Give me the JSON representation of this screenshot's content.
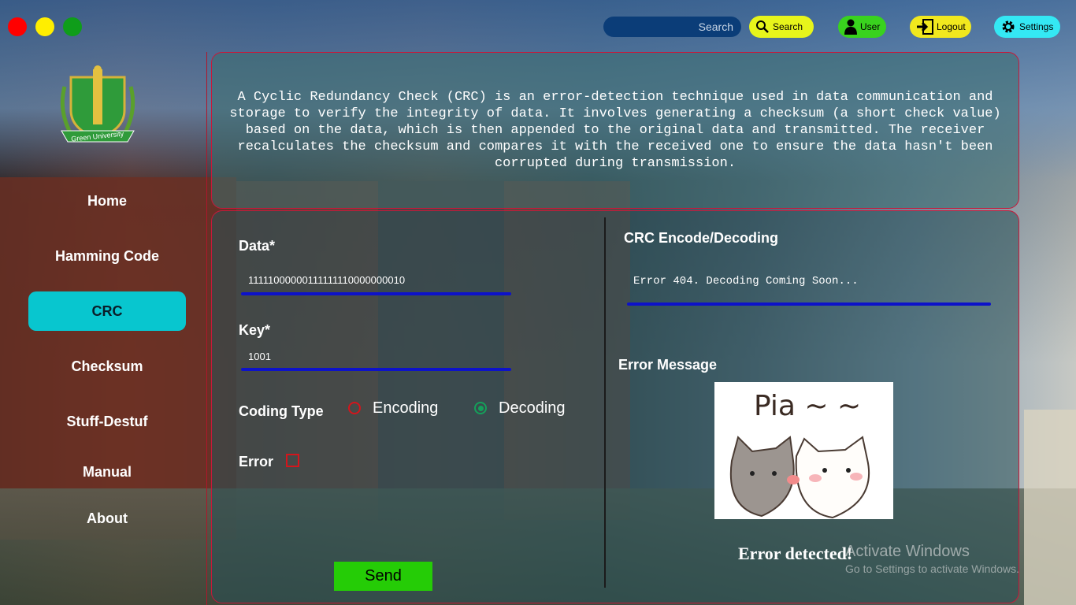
{
  "topbar": {
    "search_placeholder": "Search",
    "search_button": "Search",
    "user_button": "User",
    "logout_button": "Logout",
    "settings_button": "Settings"
  },
  "logo": {
    "text": "Green University"
  },
  "nav": [
    {
      "label": "Home",
      "active": false
    },
    {
      "label": "Hamming Code",
      "active": false
    },
    {
      "label": "CRC",
      "active": true
    },
    {
      "label": "Checksum",
      "active": false
    },
    {
      "label": "Stuff-Destuf",
      "active": false
    },
    {
      "label": "Manual",
      "active": false
    },
    {
      "label": "About",
      "active": false
    }
  ],
  "description": "A Cyclic Redundancy Check (CRC) is an error-detection technique used in data communication and storage to verify the integrity of data. It involves generating a checksum (a short check value) based on the data, which is then appended to the original data and transmitted. The receiver recalculates the checksum and compares it with the received one to ensure the data hasn't been corrupted during transmission.",
  "form": {
    "data_label": "Data*",
    "data_value": "11111000000111111110000000010",
    "key_label": "Key*",
    "key_value": "1001",
    "coding_type_label": "Coding Type",
    "encoding_label": "Encoding",
    "decoding_label": "Decoding",
    "selected": "Decoding",
    "error_label": "Error",
    "error_checked": false,
    "send_label": "Send"
  },
  "output": {
    "title": "CRC Encode/Decoding",
    "value": "Error 404. Decoding Coming Soon...",
    "error_message_label": "Error Message",
    "image_caption": "Pia ~ ~",
    "error_detected": "Error detected!"
  },
  "watermark": {
    "title": "Activate Windows",
    "subtitle": "Go to Settings to activate Windows."
  },
  "colors": {
    "accent_cyan": "#08c6cf",
    "panel_border": "#c8183a",
    "underline_blue": "#0d12c9",
    "send_green": "#25cc06"
  }
}
